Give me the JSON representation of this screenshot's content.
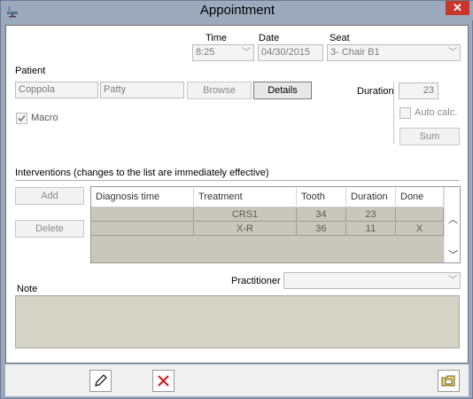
{
  "window": {
    "title": "Appointment",
    "close_label": "✕"
  },
  "time": {
    "label": "Time",
    "value": "8:25"
  },
  "date": {
    "label": "Date",
    "value": "04/30/2015"
  },
  "seat": {
    "label": "Seat",
    "value": "3- Chair B1"
  },
  "patient": {
    "label": "Patient",
    "last_name": "Coppola",
    "first_name": "Patty",
    "browse_label": "Browse",
    "details_label": "Details"
  },
  "macro": {
    "label": "Macro",
    "checked": true
  },
  "duration": {
    "label": "Duration",
    "value": "23",
    "auto_calc_label": "Auto calc.",
    "sum_label": "Sum"
  },
  "interventions": {
    "heading": "Interventions (changes to the list are immediately effective)",
    "add_label": "Add",
    "delete_label": "Delete",
    "columns": [
      "Diagnosis time",
      "Treatment",
      "Tooth",
      "Duration",
      "Done"
    ],
    "rows": [
      {
        "diagnosis_time": "",
        "treatment": "CRS1",
        "tooth": "34",
        "duration": "23",
        "done": ""
      },
      {
        "diagnosis_time": "",
        "treatment": "X-R",
        "tooth": "36",
        "duration": "11",
        "done": "X"
      }
    ]
  },
  "practitioner": {
    "label": "Practitioner",
    "value": ""
  },
  "note": {
    "label": "Note",
    "value": ""
  }
}
